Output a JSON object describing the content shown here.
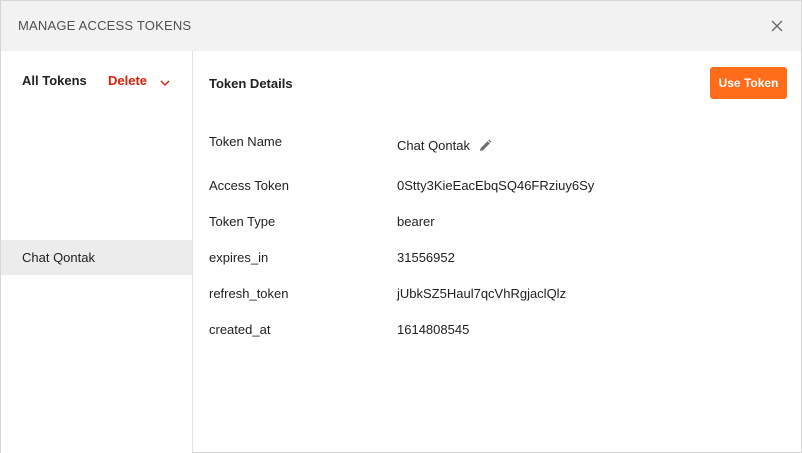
{
  "dialog": {
    "title": "MANAGE ACCESS TOKENS",
    "close_icon": "close-icon"
  },
  "sidebar": {
    "all_tokens_label": "All Tokens",
    "delete_label": "Delete",
    "delete_color": "#d3220b",
    "tokens": [
      {
        "label": "Chat Qontak",
        "selected": true
      }
    ]
  },
  "details": {
    "heading": "Token Details",
    "use_token_label": "Use Token",
    "accent_color": "#ff6c1a",
    "rows": [
      {
        "label": "Token Name",
        "value": "Chat Qontak",
        "editable": true
      },
      {
        "label": "Access Token",
        "value": "0Stty3KieEacEbqSQ46FRziuy6Sy"
      },
      {
        "label": "Token Type",
        "value": "bearer"
      },
      {
        "label": "expires_in",
        "value": "31556952"
      },
      {
        "label": "refresh_token",
        "value": "jUbkSZ5Haul7qcVhRgjaclQlz"
      },
      {
        "label": "created_at",
        "value": "1614808545"
      }
    ]
  }
}
